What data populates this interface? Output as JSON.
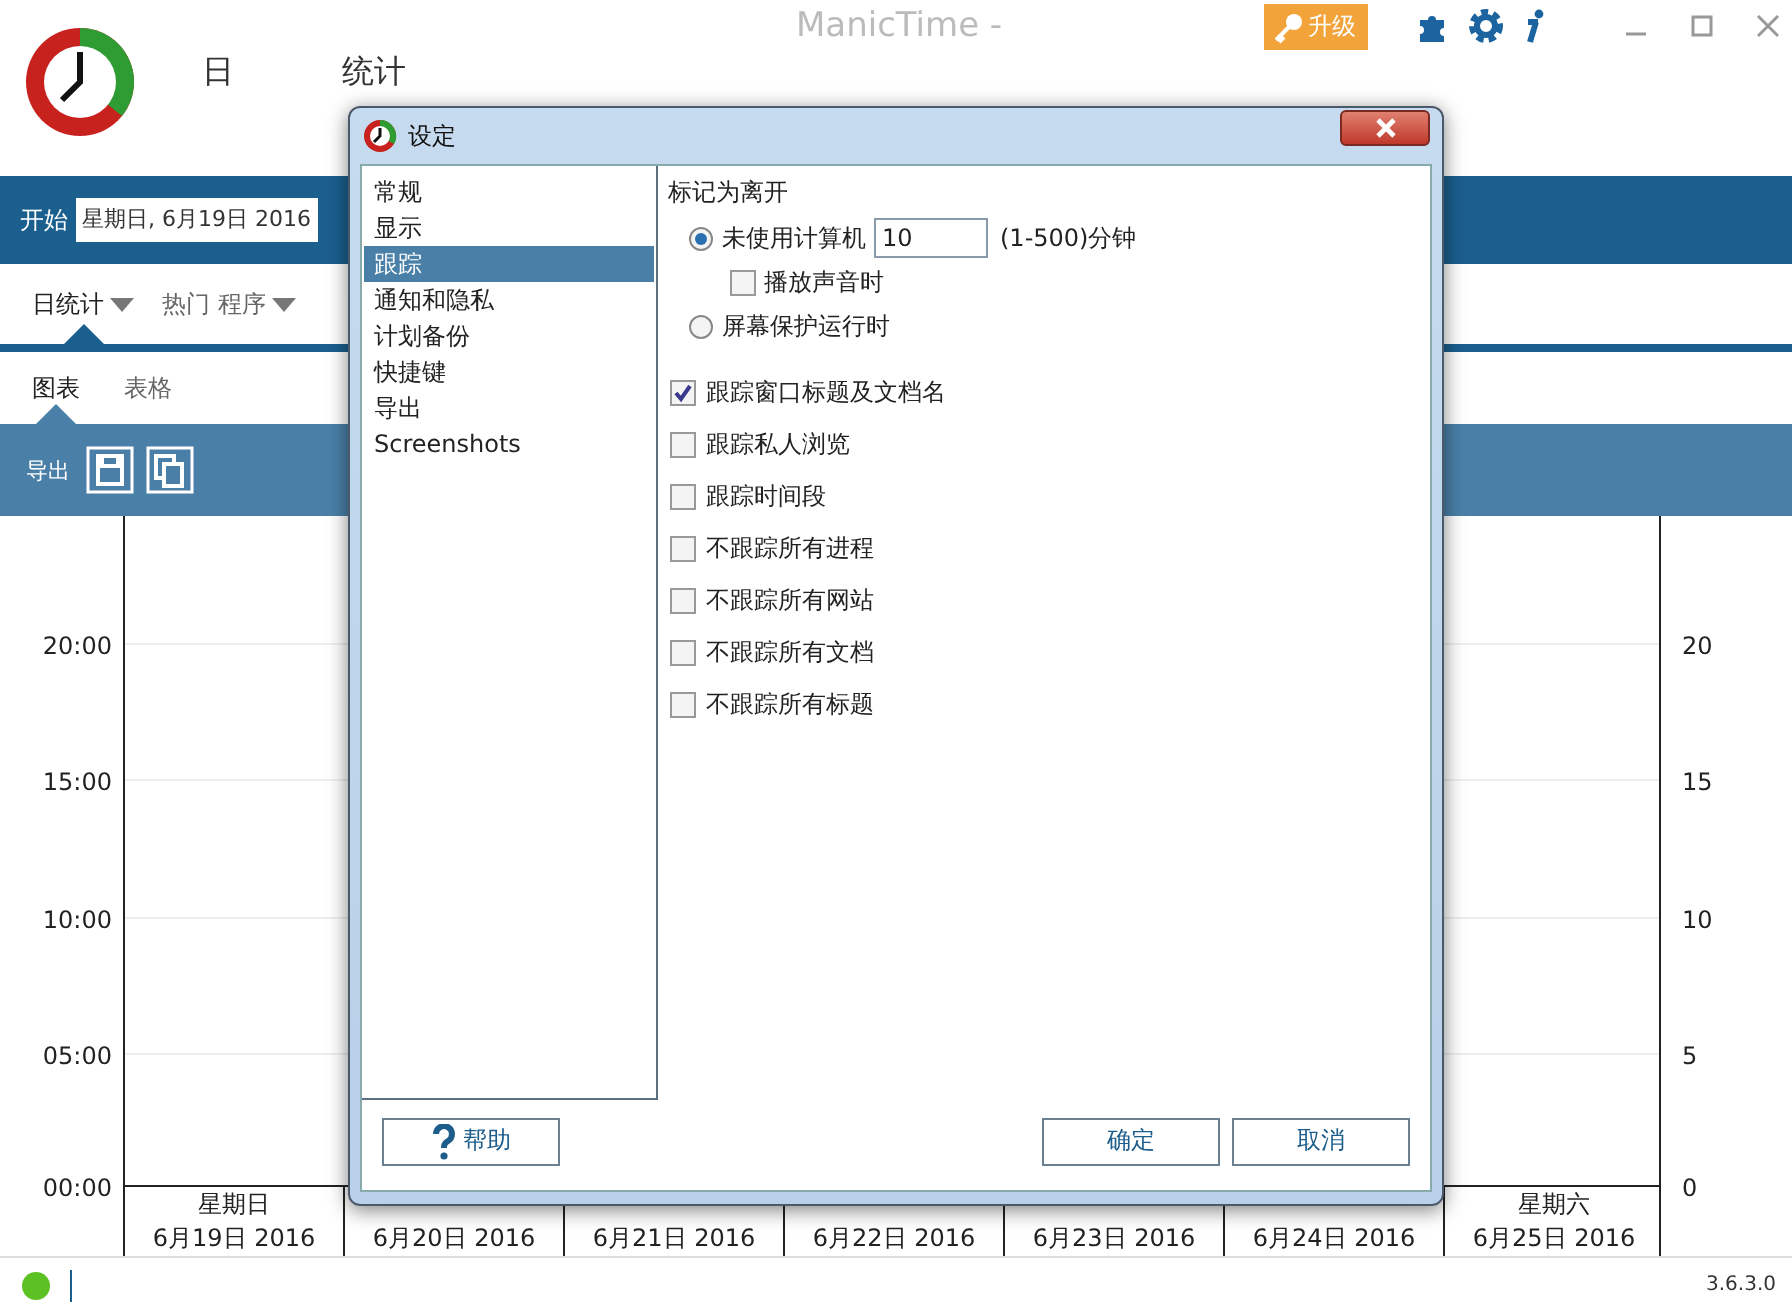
{
  "app": {
    "title": "ManicTime -",
    "upgrade": "升级",
    "nav": [
      {
        "label": "日"
      },
      {
        "label": "统计"
      }
    ],
    "start_label": "开始",
    "start_date": "星期日, 6月19日 2016",
    "view_tabs": [
      {
        "label": "日统计",
        "selected": true
      },
      {
        "label": "热门 程序",
        "selected": false
      }
    ],
    "sub_tabs": [
      {
        "label": "图表",
        "selected": true
      },
      {
        "label": "表格",
        "selected": false
      }
    ],
    "export_label": "导出",
    "chart": {
      "left_ticks": [
        "20:00",
        "15:00",
        "10:00",
        "05:00",
        "00:00"
      ],
      "right_ticks": [
        "20",
        "15",
        "10",
        "5",
        "0"
      ],
      "days": [
        {
          "weekday": "星期日",
          "date": "6月19日 2016"
        },
        {
          "date": "6月20日 2016"
        },
        {
          "date": "6月21日 2016"
        },
        {
          "date": "6月22日 2016"
        },
        {
          "date": "6月23日 2016"
        },
        {
          "date": "6月24日 2016"
        },
        {
          "weekday": "星期六",
          "date": "6月25日 2016"
        }
      ]
    },
    "status_bar": {
      "version": "3.6.3.0"
    }
  },
  "dialog": {
    "title": "设定",
    "categories": [
      {
        "label": "常规",
        "selected": false
      },
      {
        "label": "显示",
        "selected": false
      },
      {
        "label": "跟踪",
        "selected": true
      },
      {
        "label": "通知和隐私",
        "selected": false
      },
      {
        "label": "计划备份",
        "selected": false
      },
      {
        "label": "快捷键",
        "selected": false
      },
      {
        "label": "导出",
        "selected": false
      },
      {
        "label": "Screenshots",
        "selected": false
      }
    ],
    "away": {
      "title": "标记为离开",
      "items": [
        {
          "kind": "radio",
          "label": "未使用计算机",
          "selected": true,
          "value": "10",
          "unit": "(1-500)分钟"
        },
        {
          "kind": "checkbox",
          "label": "播放声音时",
          "checked": false
        },
        {
          "kind": "radio",
          "label": "屏幕保护运行时",
          "selected": false
        }
      ]
    },
    "tracking": [
      {
        "label": "跟踪窗口标题及文档名",
        "checked": true
      },
      {
        "label": "跟踪私人浏览",
        "checked": false
      },
      {
        "label": "跟踪时间段",
        "checked": false
      },
      {
        "label": "不跟踪所有进程",
        "checked": false
      },
      {
        "label": "不跟踪所有网站",
        "checked": false
      },
      {
        "label": "不跟踪所有文档",
        "checked": false
      },
      {
        "label": "不跟踪所有标题",
        "checked": false
      }
    ],
    "buttons": {
      "help": "帮助",
      "ok": "确定",
      "cancel": "取消"
    }
  }
}
